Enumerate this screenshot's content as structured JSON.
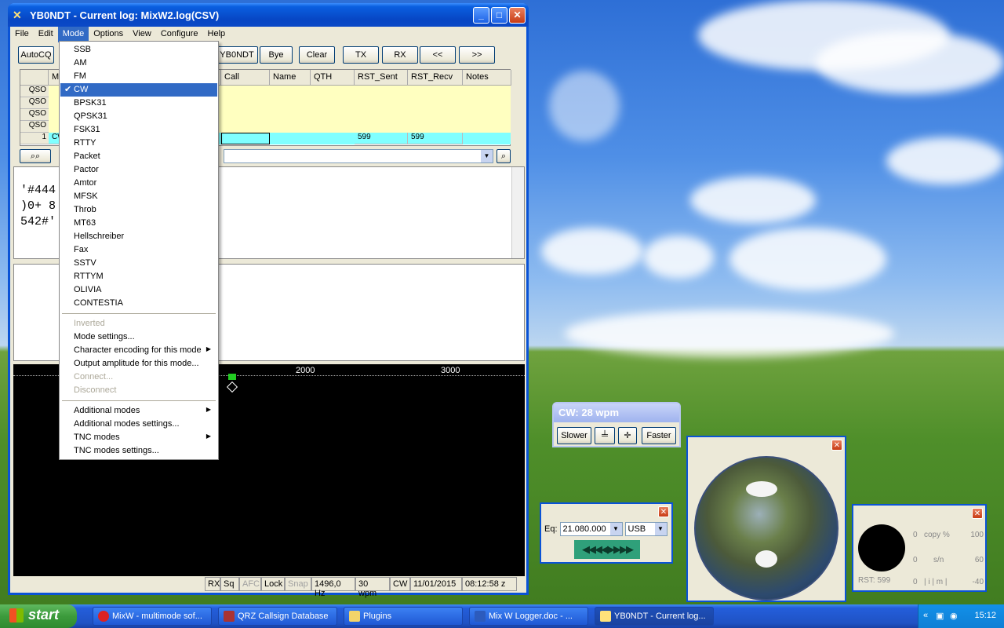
{
  "window": {
    "title": "YB0NDT - Current log: MixW2.log(CSV)",
    "menu": [
      "File",
      "Edit",
      "Mode",
      "Options",
      "View",
      "Configure",
      "Help"
    ],
    "toolbar": [
      "AutoCQ",
      "YB0NDT",
      "Bye",
      "Clear",
      "TX",
      "RX",
      "<<",
      ">>"
    ]
  },
  "log_grid": {
    "columns": [
      "M",
      "Call",
      "Name",
      "QTH",
      "RST_Sent",
      "RST_Recv",
      "Notes"
    ],
    "row_labels": [
      "QSO",
      "QSO",
      "QSO",
      "QSO",
      "1"
    ],
    "current_row": {
      "mode": "CW",
      "rst_sent": "599",
      "rst_recv": "599"
    }
  },
  "rx_text": [
    "'#444",
    ")0+ 8",
    "542#'"
  ],
  "waterfall": {
    "scale": [
      "2000",
      "3000"
    ]
  },
  "statusbar": [
    "RX",
    "Sq",
    "AFC",
    "Lock",
    "Snap",
    "1496,0 Hz",
    "30 wpm",
    "CW",
    "11/01/2015",
    "08:12:58 z"
  ],
  "mode_menu": {
    "modes": [
      "SSB",
      "AM",
      "FM",
      "CW",
      "BPSK31",
      "QPSK31",
      "FSK31",
      "RTTY",
      "Packet",
      "Pactor",
      "Amtor",
      "MFSK",
      "Throb",
      "MT63",
      "Hellschreiber",
      "Fax",
      "SSTV",
      "RTTYM",
      "OLIVIA",
      "CONTESTIA"
    ],
    "selected": "CW",
    "group2": [
      "Inverted",
      "Mode settings...",
      "Character encoding for this mode",
      "Output amplitude for this mode...",
      "Connect...",
      "Disconnect"
    ],
    "group3": [
      "Additional modes",
      "Additional modes settings...",
      "TNC modes",
      "TNC modes settings..."
    ]
  },
  "cw_window": {
    "title": "CW: 28 wpm",
    "slower": "Slower",
    "faster": "Faster"
  },
  "freq_window": {
    "label": "Eq:",
    "freq": "21.080.000",
    "mode": "USB",
    "tuner": "◀◀◀◀▶▶▶▶"
  },
  "meter_window": {
    "rows": [
      [
        "0",
        "copy %",
        "100"
      ],
      [
        "0",
        "s/n",
        "60"
      ],
      [
        "0",
        "| i | m |",
        "-40"
      ]
    ],
    "rst": "RST: 599"
  },
  "taskbar": {
    "start": "start",
    "tasks": [
      "MixW - multimode sof...",
      "QRZ Callsign Database",
      "Plugins",
      "Mix W  Logger.doc - ...",
      "YB0NDT - Current log..."
    ],
    "clock": "15:12"
  }
}
